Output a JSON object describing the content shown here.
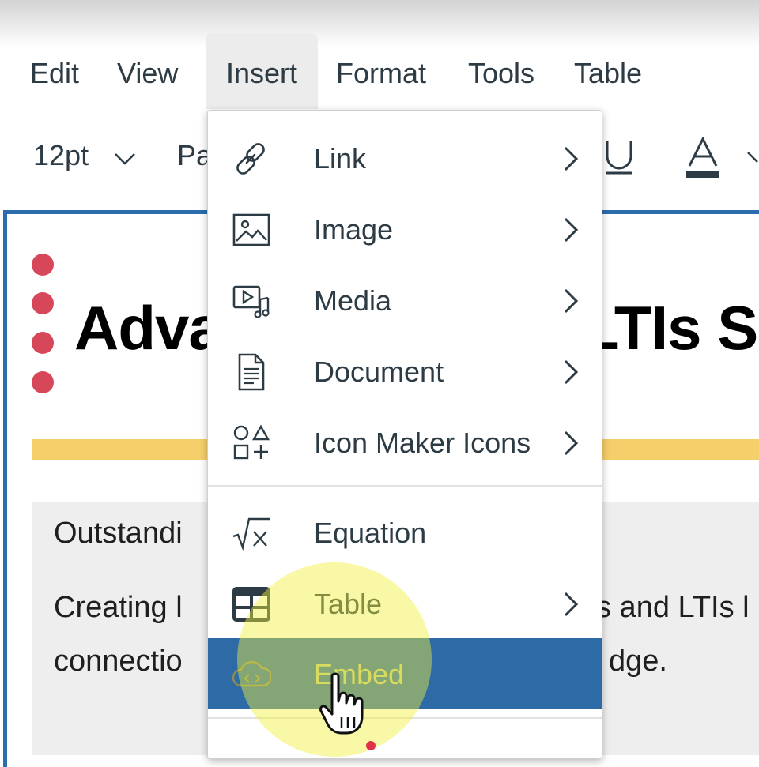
{
  "menubar": {
    "items": [
      "Edit",
      "View",
      "Insert",
      "Format",
      "Tools",
      "Table"
    ],
    "active": "Insert"
  },
  "toolbar": {
    "font_size": "12pt",
    "paragraph_partial": "Pa",
    "underline_icon": "underline-icon",
    "text_color_icon": "text-color-icon"
  },
  "document": {
    "heading_left": "Adva",
    "heading_right": "LTIs S",
    "section_title_partial": "Outstandi",
    "body_line1_left": "Creating l",
    "body_line1_right": "s and LTIs l",
    "body_line2_left": "connectio",
    "body_line2_right": "dge.",
    "colors": {
      "accent_bar": "#f5cf6a",
      "bullet": "#d7475a",
      "editor_border": "#2b6dad"
    }
  },
  "insert_menu": {
    "items": [
      {
        "label": "Link",
        "icon": "link-icon",
        "submenu": true
      },
      {
        "label": "Image",
        "icon": "image-icon",
        "submenu": true
      },
      {
        "label": "Media",
        "icon": "media-icon",
        "submenu": true
      },
      {
        "label": "Document",
        "icon": "document-icon",
        "submenu": true
      },
      {
        "label": "Icon Maker Icons",
        "icon": "icon-maker-icon",
        "submenu": true
      },
      {
        "label": "Equation",
        "icon": "equation-icon",
        "submenu": false
      },
      {
        "label": "Table",
        "icon": "table-icon",
        "submenu": true
      },
      {
        "label": "Embed",
        "icon": "cloud-embed-icon",
        "submenu": false,
        "highlighted": true
      }
    ],
    "highlight_color": "#2d6aa6"
  }
}
